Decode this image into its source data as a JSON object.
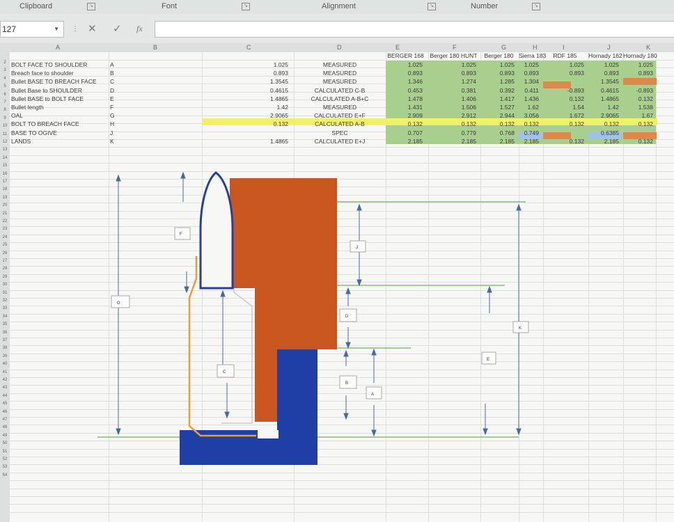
{
  "ribbon": {
    "clipboard": "Clipboard",
    "font": "Font",
    "alignment": "Alignment",
    "number": "Number"
  },
  "formula_bar": {
    "name_box": "127",
    "cancel_icon": "✕",
    "enter_icon": "✓",
    "fx": "fx",
    "content": ""
  },
  "columns": [
    "A",
    "B",
    "C",
    "D",
    "E",
    "F",
    "G",
    "H",
    "I",
    "J",
    "K"
  ],
  "rows": [
    "2",
    "3",
    "4",
    "5",
    "6",
    "7",
    "8",
    "9",
    "10",
    "11",
    "12",
    "13",
    "14",
    "15",
    "16",
    "17",
    "18",
    "19",
    "20",
    "21",
    "22",
    "23",
    "24",
    "25",
    "26",
    "27",
    "28",
    "29",
    "30",
    "31",
    "32",
    "33",
    "34",
    "35",
    "36",
    "37",
    "38",
    "39",
    "40",
    "41",
    "42",
    "43",
    "44",
    "45",
    "46",
    "47",
    "48",
    "49",
    "50",
    "51",
    "52",
    "53",
    "54"
  ],
  "header_row": [
    "BERGER 168",
    "Berger 180 HUNT",
    "Berger 180",
    "Sierra 183",
    "RDF 185",
    "Hornady 162",
    "Hornady 180"
  ],
  "table": [
    {
      "a": "BOLT FACE TO SHOULDER",
      "b": "A",
      "c": "1.025",
      "d": "MEASURED",
      "vals": [
        "1.025",
        "1.025",
        "1.025",
        "1.025",
        "1.025",
        "1.025",
        "1.025"
      ]
    },
    {
      "a": "Breach face to shoulder",
      "b": "B",
      "c": "0.893",
      "d": "MEASURED",
      "vals": [
        "0.893",
        "0.893",
        "0.893",
        "0.893",
        "0.893",
        "0.893",
        "0.893"
      ]
    },
    {
      "a": "Bullet BASE TO BREACH FACE",
      "b": "C",
      "c": "1.3545",
      "d": "MEASURED",
      "vals": [
        "1.346",
        "1.274",
        "1.285",
        "1.304",
        "",
        "1.3545",
        ""
      ]
    },
    {
      "a": "Bullet Base to SHOULDER",
      "b": "D",
      "c": "0.4615",
      "d": "CALCULATED C-B",
      "vals": [
        "0.453",
        "0.381",
        "0.392",
        "0.411",
        "-0.893",
        "0.4615",
        "-0.893"
      ]
    },
    {
      "a": "Bullet BASE to BOLT FACE",
      "b": "E",
      "c": "1.4865",
      "d": "CALCULATED A-B+C",
      "vals": [
        "1.478",
        "1.406",
        "1.417",
        "1.436",
        "0.132",
        "1.4865",
        "0.132"
      ]
    },
    {
      "a": "Bullet length",
      "b": "F",
      "c": "1.42",
      "d": "MEASURED",
      "vals": [
        "1.431",
        "1.506",
        "1.527",
        "1.62",
        "1.54",
        "1.42",
        "1.538"
      ]
    },
    {
      "a": "OAL",
      "b": "G",
      "c": "2.9065",
      "d": "CALCULATED E+F",
      "vals": [
        "2.909",
        "2.912",
        "2.944",
        "3.056",
        "1.672",
        "2.9065",
        "1.67"
      ]
    },
    {
      "a": "BOLT TO BREACH FACE",
      "b": "H",
      "c": "0.132",
      "d": "CALCULATED A-B",
      "vals": [
        "0.132",
        "0.132",
        "0.132",
        "0.132",
        "0.132",
        "0.132",
        "0.132"
      ]
    },
    {
      "a": "BASE TO OGIVE",
      "b": "J",
      "c": "",
      "d": "SPEC",
      "vals": [
        "0.707",
        "0.779",
        "0.768",
        "0.749",
        "",
        "0.6385",
        ""
      ]
    },
    {
      "a": "LANDS",
      "b": "K",
      "c": "1.4865",
      "d": "CALCULATED E+J",
      "vals": [
        "2.185",
        "2.185",
        "2.185",
        "2.185",
        "0.132",
        "2.185",
        "0.132"
      ]
    }
  ],
  "diagram_labels": {
    "F": "F",
    "G": "G",
    "C": "C",
    "D": "D",
    "B": "B",
    "A": "A",
    "J": "J",
    "E": "E",
    "K": "K"
  },
  "colors": {
    "green": "#a9cf8e",
    "yellow": "#f2ef6a",
    "orange": "#e0874a",
    "blue_fill": "#9fc3e6",
    "case_orange": "#c9561f",
    "bolt_blue": "#1f3fa6",
    "bullet_outline": "#2a3f9a",
    "brass": "#e2a13a"
  }
}
